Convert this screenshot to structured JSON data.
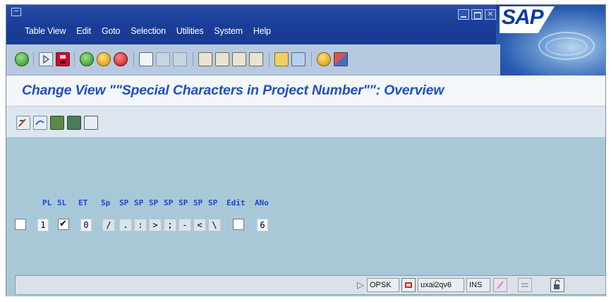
{
  "window": {
    "title_icon": "system-menu-icon",
    "menu": [
      "Table View",
      "Edit",
      "Goto",
      "Selection",
      "Utilities",
      "System",
      "Help"
    ],
    "logo_text": "SAP"
  },
  "toolbar": {
    "icons": [
      "enter-icon",
      "command-field-icon",
      "save-icon",
      "back-icon",
      "exit-icon",
      "cancel-icon",
      "print-icon",
      "find-icon",
      "find-next-icon",
      "first-page-icon",
      "previous-page-icon",
      "next-page-icon",
      "last-page-icon",
      "create-session-icon",
      "shortcut-icon",
      "help-icon",
      "layout-menu-icon"
    ]
  },
  "screen": {
    "title": "Change View \"\"Special Characters in Project Number\"\": Overview"
  },
  "app_toolbar": {
    "icons": [
      "display-change-icon",
      "other-view-icon",
      "select-all-icon",
      "select-block-icon",
      "deselect-all-icon"
    ]
  },
  "table": {
    "headers": [
      "PL",
      "SL",
      "ET",
      "Sp",
      "SP",
      "SP",
      "SP",
      "SP",
      "SP",
      "SP",
      "SP",
      "Edit",
      "ANo"
    ],
    "row": {
      "selected": false,
      "pl": "1",
      "sl_checked": true,
      "et": "0",
      "sp": [
        "/",
        ".",
        ":",
        ">",
        ";",
        "-",
        "<",
        "\\"
      ],
      "edit_checked": false,
      "ano": "6"
    }
  },
  "status": {
    "message": "",
    "system": "OPSK",
    "server": "uxai2qv6",
    "mode": "INS"
  },
  "colors": {
    "title_blue": "#2050c0",
    "menubar_blue": "#1b3f9a",
    "workarea": "#a8c8d8"
  }
}
